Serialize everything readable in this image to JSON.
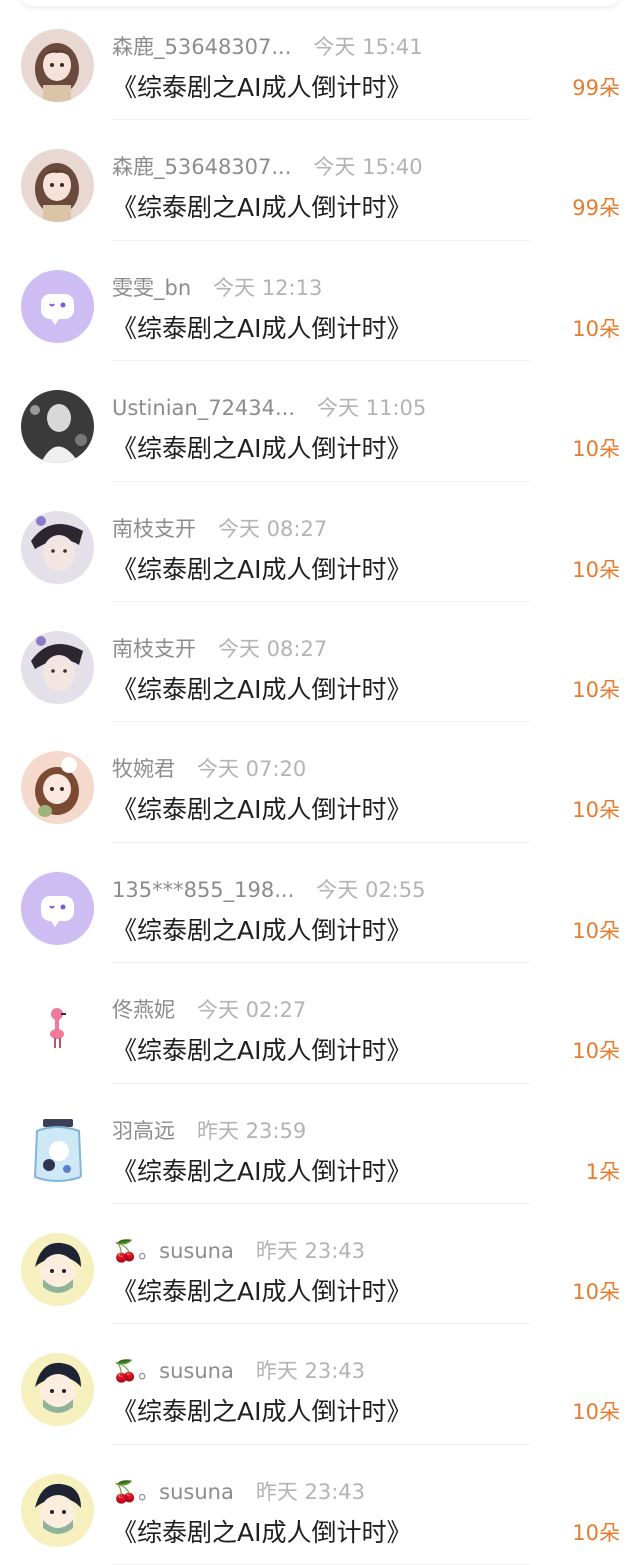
{
  "colors": {
    "name": "#8c8c8c",
    "time": "#b3b3b3",
    "title": "#1f1f1f",
    "count": "#e57c2f"
  },
  "rows": [
    {
      "avatar": "girl-avatar",
      "name": "森鹿_53648307...",
      "time": "今天 15:41",
      "title": "《综泰剧之AI成人倒计时》",
      "count": "99朵"
    },
    {
      "avatar": "girl-avatar",
      "name": "森鹿_53648307...",
      "time": "今天 15:40",
      "title": "《综泰剧之AI成人倒计时》",
      "count": "99朵"
    },
    {
      "avatar": "default-chat-avatar",
      "name": "雯雯_bn",
      "time": "今天 12:13",
      "title": "《综泰剧之AI成人倒计时》",
      "count": "10朵"
    },
    {
      "avatar": "bw-photo-avatar",
      "name": "Ustinian_72434...",
      "time": "今天 11:05",
      "title": "《综泰剧之AI成人倒计时》",
      "count": "10朵"
    },
    {
      "avatar": "boy-avatar",
      "name": "南枝支开",
      "time": "今天 08:27",
      "title": "《综泰剧之AI成人倒计时》",
      "count": "10朵"
    },
    {
      "avatar": "boy-avatar",
      "name": "南枝支开",
      "time": "今天 08:27",
      "title": "《综泰剧之AI成人倒计时》",
      "count": "10朵"
    },
    {
      "avatar": "cartoon-girl-avatar",
      "name": "牧婉君",
      "time": "今天 07:20",
      "title": "《综泰剧之AI成人倒计时》",
      "count": "10朵"
    },
    {
      "avatar": "default-chat-avatar",
      "name": "135***855_198...",
      "time": "今天 02:55",
      "title": "《综泰剧之AI成人倒计时》",
      "count": "10朵"
    },
    {
      "avatar": "flamingo-avatar",
      "name": "佟燕妮",
      "time": "今天 02:27",
      "title": "《综泰剧之AI成人倒计时》",
      "count": "10朵"
    },
    {
      "avatar": "jar-avatar",
      "name": "羽高远",
      "time": "昨天 23:59",
      "title": "《综泰剧之AI成人倒计时》",
      "count": "1朵"
    },
    {
      "avatar": "mask-boy-avatar",
      "name": "🍒。susuna",
      "time": "昨天 23:43",
      "title": "《综泰剧之AI成人倒计时》",
      "count": "10朵"
    },
    {
      "avatar": "mask-boy-avatar",
      "name": "🍒。susuna",
      "time": "昨天 23:43",
      "title": "《综泰剧之AI成人倒计时》",
      "count": "10朵"
    },
    {
      "avatar": "mask-boy-avatar",
      "name": "🍒。susuna",
      "time": "昨天 23:43",
      "title": "《综泰剧之AI成人倒计时》",
      "count": "10朵"
    }
  ]
}
